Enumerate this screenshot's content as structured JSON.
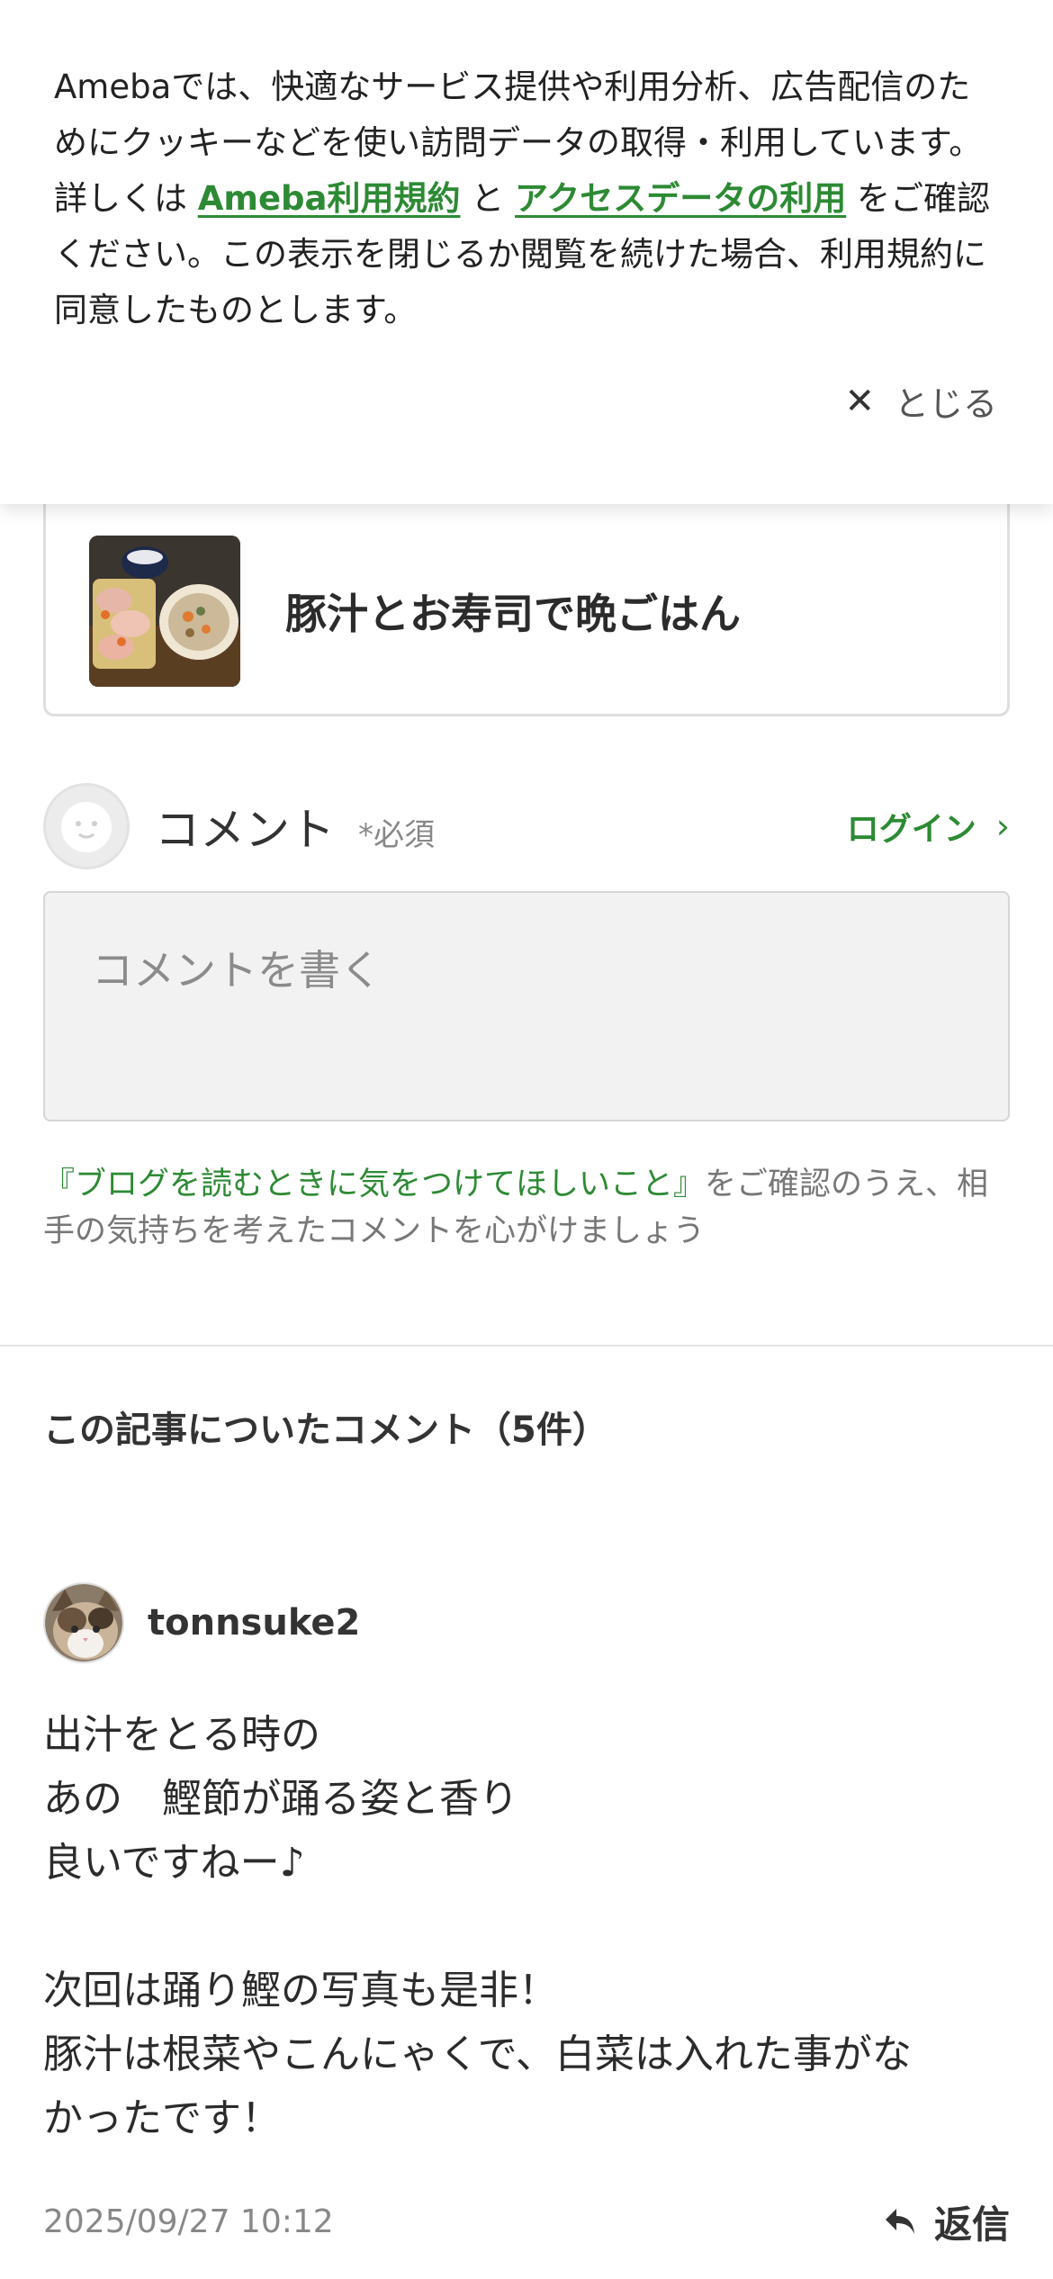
{
  "cookie_banner": {
    "text_1": "Amebaでは、快適なサービス提供や利用分析、広告配信のためにクッキーなどを使い訪問データの取得・利用しています。詳しくは ",
    "terms_link": "Ameba利用規約",
    "text_2": " と ",
    "access_link": "アクセスデータの利用",
    "text_3": " をご確認ください。この表示を閉じるか閲覧を続けた場合、利用規約に同意したものとします。",
    "close_label": "とじる",
    "close_icon": "close-icon"
  },
  "article_card": {
    "title": "豚汁とお寿司で晩ごはん",
    "thumbnail": "food-photo"
  },
  "comment_form": {
    "label": "コメント",
    "required": "*必須",
    "login_label": "ログイン",
    "placeholder": "コメントを書く",
    "guideline_link": "『ブログを読むときに気をつけてほしいこと』",
    "guideline_text": "をご確認のうえ、相手の気持ちを考えたコメントを心がけましょう"
  },
  "comments": {
    "heading": "この記事についたコメント（5件）",
    "items": [
      {
        "author": "tonnsuke2",
        "lines": [
          "出汁をとる時の",
          "あの　鰹節が踊る姿と香り",
          "良いですねー♪",
          "",
          "次回は踊り鰹の写真も是非！",
          "豚汁は根菜やこんにゃくで、白菜は入れた事がな",
          "かったです！"
        ],
        "date": "2025/09/27 10:12",
        "reply_label": "返信"
      }
    ]
  },
  "colors": {
    "accent_green": "#2d8a34",
    "text": "#2b2b2b",
    "muted": "#888888"
  }
}
